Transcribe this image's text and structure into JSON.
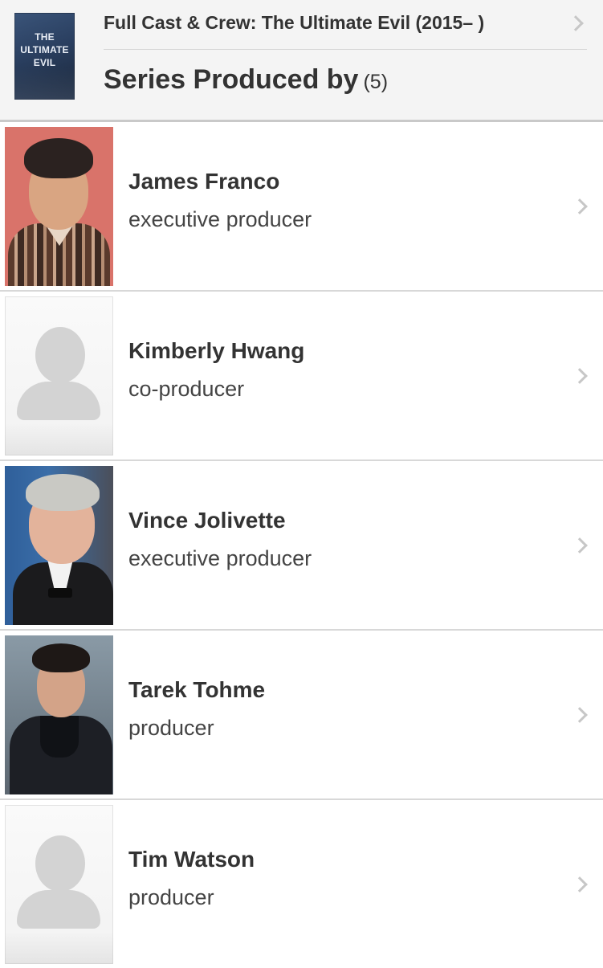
{
  "header": {
    "poster_lines": [
      "THE",
      "ULTIMATE",
      "EVIL"
    ],
    "breadcrumb": "Full Cast & Crew: The Ultimate Evil (2015– )",
    "section_title": "Series Produced by",
    "section_count": "(5)"
  },
  "people": [
    {
      "name": "James Franco",
      "role": "executive producer",
      "photo": "portrait"
    },
    {
      "name": "Kimberly Hwang",
      "role": "co-producer",
      "photo": "placeholder-silhouette"
    },
    {
      "name": "Vince Jolivette",
      "role": "executive producer",
      "photo": "portrait"
    },
    {
      "name": "Tarek Tohme",
      "role": "producer",
      "photo": "portrait"
    },
    {
      "name": "Tim Watson",
      "role": "producer",
      "photo": "placeholder-silhouette"
    }
  ],
  "icons": {
    "row_chevron": "chevron-right-icon",
    "header_chevron": "chevron-right-icon"
  },
  "colors": {
    "header_bg": "#f4f4f4",
    "text": "#333333",
    "divider": "#d8d8d8",
    "chevron": "#c7c7c7"
  }
}
